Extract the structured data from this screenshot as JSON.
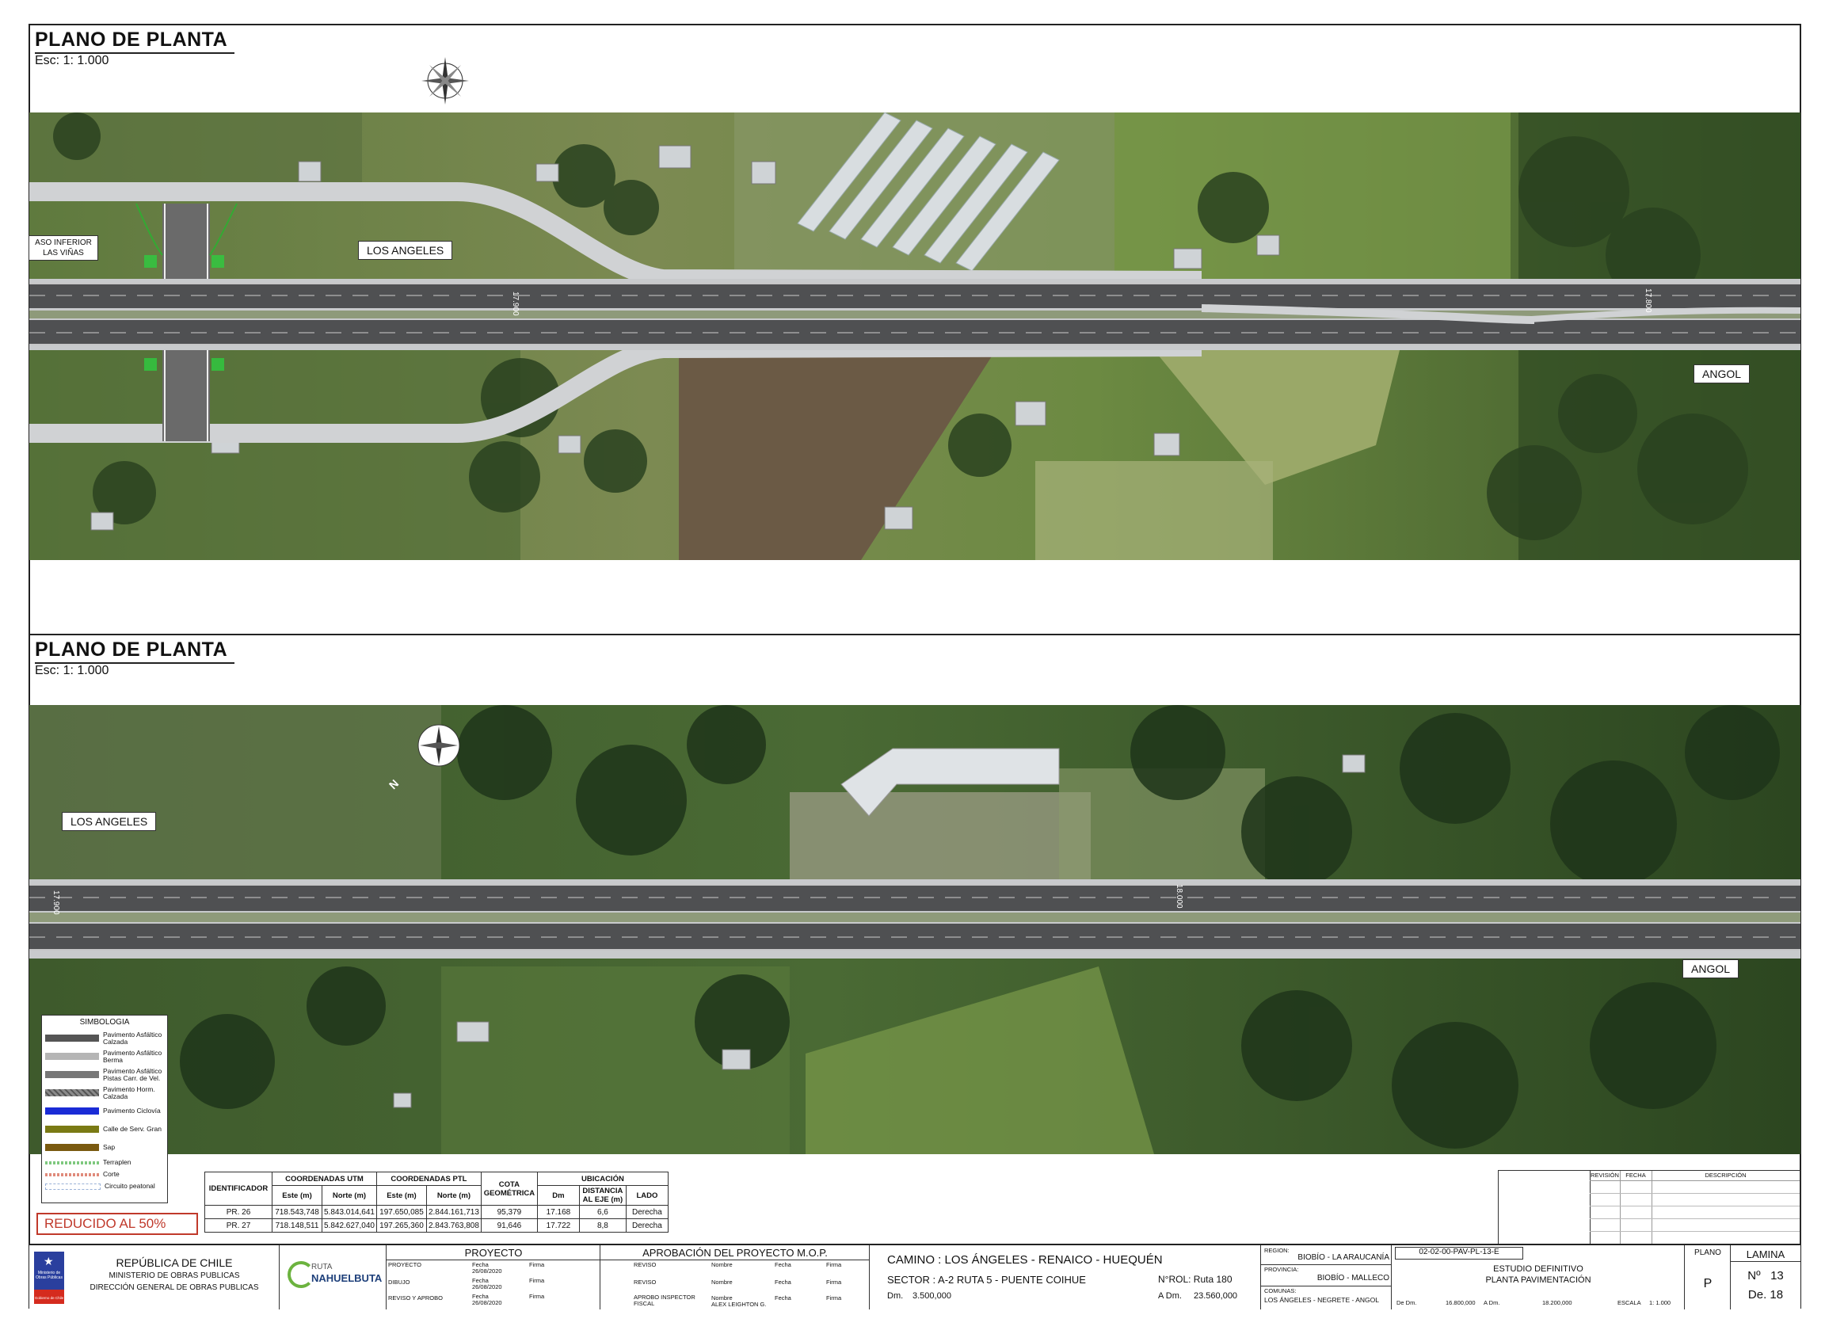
{
  "sheet1": {
    "title": "PLANO DE PLANTA",
    "scale": "Esc: 1: 1.000",
    "labels": {
      "paso_inferior": "ASO INFERIOR LAS VIÑAS",
      "los_angeles": "LOS ANGELES",
      "angol": "ANGOL",
      "km_left": "17.900",
      "km_right": "17.800",
      "north": "N"
    }
  },
  "sheet2": {
    "title": "PLANO DE PLANTA",
    "scale": "Esc: 1: 1.000",
    "labels": {
      "los_angeles": "LOS ANGELES",
      "angol": "ANGOL",
      "km_left": "17.900",
      "km_mid": "18.000",
      "north": "N"
    }
  },
  "legend": {
    "title": "SIMBOLOGIA",
    "items": [
      {
        "label": "Pavimento Asfáltico Calzada",
        "color": "#555555"
      },
      {
        "label": "Pavimento Asfáltico Berma",
        "color": "#b5b5b5"
      },
      {
        "label": "Pavimento Asfáltico Pistas Carr. de Vel.",
        "color": "#777777"
      },
      {
        "label": "Pavimento Horm. Calzada",
        "color": "#8a8a8a"
      },
      {
        "label": "Pavimento Ciclovía",
        "color": "#1a2bd6"
      },
      {
        "label": "Calle de Serv. Gran",
        "color": "#7a7a14"
      },
      {
        "label": "Sap",
        "color": "#7a5a10"
      },
      {
        "label": "Terraplen",
        "color": "#7ec87e"
      },
      {
        "label": "Corte",
        "color": "#e08a7a"
      },
      {
        "label": "Circuito peatonal",
        "color": "#9ab2d8"
      }
    ]
  },
  "coord_table": {
    "headers": {
      "identificador": "IDENTIFICADOR",
      "utm": "COORDENADAS UTM",
      "ptl": "COORDENADAS PTL",
      "cota": "COTA GEOMÉTRICA",
      "ubicacion": "UBICACIÓN",
      "este": "Este (m)",
      "norte": "Norte (m)",
      "dm": "Dm",
      "distancia": "DISTANCIA AL EJE (m)",
      "lado": "LADO"
    },
    "rows": [
      [
        "PR. 26",
        "718.543,748",
        "5.843.014,641",
        "197.650,085",
        "2.844.161,713",
        "95,379",
        "17.168",
        "6,6",
        "Derecha"
      ],
      [
        "PR. 27",
        "718.148,511",
        "5.842.627,040",
        "197.265,360",
        "2.843.763,808",
        "91,646",
        "17.722",
        "8,8",
        "Derecha"
      ]
    ]
  },
  "reduced_note": "REDUCIDO AL 50%",
  "revision_table": {
    "col1": "REVISIÓN",
    "col2": "FECHA",
    "col3": "DESCRIPCIÓN"
  },
  "title_block": {
    "gov_line1": "REPÚBLICA DE CHILE",
    "gov_line2": "MINISTERIO DE OBRAS PUBLICAS",
    "gov_line3": "DIRECCIÓN GENERAL DE OBRAS PUBLICAS",
    "logo_small": "Ministerio de Obras Públicas",
    "logo_footer": "Gobierno de Chile",
    "ruta_line1": "RUTA",
    "ruta_line2": "NAHUELBUTA",
    "proyecto_header": "PROYECTO",
    "proyecto_rows": [
      {
        "role": "PROYECTO",
        "fecha_label": "Fecha",
        "fecha": "26/08/2020",
        "firma": "Firma"
      },
      {
        "role": "DIBUJO",
        "fecha_label": "Fecha",
        "fecha": "26/08/2020",
        "firma": "Firma"
      },
      {
        "role": "REVISO Y APROBO",
        "fecha_label": "Fecha",
        "fecha": "26/08/2020",
        "firma": "Firma"
      }
    ],
    "aprobacion_header": "APROBACIÓN DEL PROYECTO M.O.P.",
    "aprobacion_rows": [
      {
        "role": "REVISO",
        "nombre_label": "Nombre",
        "nombre": "",
        "fecha": "Fecha",
        "firma": "Firma"
      },
      {
        "role": "REVISO",
        "nombre_label": "Nombre",
        "nombre": "",
        "fecha": "Fecha",
        "firma": "Firma"
      },
      {
        "role": "APROBO INSPECTOR FISCAL",
        "nombre_label": "Nombre",
        "nombre": "ALEX LEIGHTON G.",
        "fecha": "Fecha",
        "firma": "Firma"
      }
    ],
    "camino": "CAMINO : LOS ÁNGELES - RENAICO - HUEQUÉN",
    "sector": "SECTOR : A-2  RUTA 5 - PUENTE COIHUE",
    "rol": "N°ROL: Ruta 180",
    "dm_label": "Dm.",
    "dm_value": "3.500,000",
    "adm_label": "A Dm.",
    "adm_value": "23.560,000",
    "region_label": "REGION:",
    "region_value": "BIOBÍO - LA ARAUCANÍA",
    "provincia_label": "PROVINCIA:",
    "provincia_value": "BIOBÍO - MALLECO",
    "comunas_label": "COMUNAS:",
    "comunas_value": "LOS ÁNGELES - NEGRETE - ANGOL",
    "codigo": "02-02-00-PAV-PL-13-E",
    "estudio_line1": "ESTUDIO DEFINITIVO",
    "estudio_line2": "PLANTA PAVIMENTACIÓN",
    "de_dm_label": "De Dm.",
    "de_dm_value": "16.800,000",
    "a_dm_label": "A Dm.",
    "a_dm_value": "18.200,000",
    "escala_label": "ESCALA",
    "escala_value": "1: 1.000",
    "plano_label": "PLANO",
    "plano_value": "P",
    "lamina_label": "LAMINA",
    "lamina_no": "Nº   13",
    "lamina_de": "De. 18"
  }
}
